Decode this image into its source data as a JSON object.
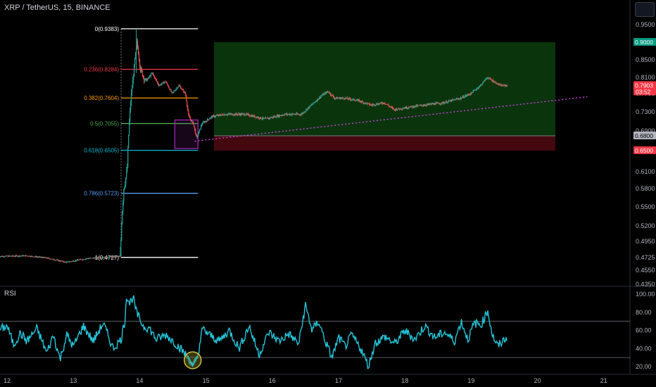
{
  "chart": {
    "symbol": "XRP / TetherUS, 15, BINANCE",
    "indicator_label": "RSI"
  },
  "chart_data": [
    {
      "type": "candlestick",
      "title": "XRP / TetherUS, 15, BINANCE",
      "x_ticks": [
        "12",
        "13",
        "14",
        "15",
        "16",
        "17",
        "18",
        "19",
        "20",
        "21"
      ],
      "x_tick_pos": [
        12,
        13,
        14,
        15,
        16,
        17,
        18,
        19,
        20,
        21
      ],
      "xlim": [
        11.87,
        21.37
      ],
      "y_ticks": [
        0.435,
        0.455,
        0.4725,
        0.495,
        0.52,
        0.55,
        0.58,
        0.61,
        0.65,
        0.69,
        0.73,
        0.77,
        0.81,
        0.85,
        0.9,
        0.95
      ],
      "y_tick_labels": [
        "0.4350",
        "0.4550",
        "0.4725",
        "0.4950",
        "0.5200",
        "0.5500",
        "0.5800",
        "0.6100",
        "0.6500",
        "0.6900",
        "0.7300",
        "0.7700",
        "0.8100",
        "0.8500",
        "0.9000",
        "0.9500"
      ],
      "fib_levels": [
        {
          "label": "0(0.9383)",
          "value": 0.9383,
          "color": "#ffffff"
        },
        {
          "label": "0.236(0.8284)",
          "value": 0.8284,
          "color": "#f23645"
        },
        {
          "label": "0.382(0.7604)",
          "value": 0.7604,
          "color": "#ff9800"
        },
        {
          "label": "0.5(0.7055)",
          "value": 0.7055,
          "color": "#4caf50"
        },
        {
          "label": "0.618(0.6505)",
          "value": 0.6505,
          "color": "#00bcd4"
        },
        {
          "label": "0.786(0.5723)",
          "value": 0.5723,
          "color": "#5b9cf6"
        },
        {
          "label": "1(0.4727)",
          "value": 0.4727,
          "color": "#ffffff"
        }
      ],
      "fib_x_range": [
        13.72,
        14.88
      ],
      "long_position": {
        "x_start": 15.12,
        "x_end": 20.27,
        "entry": 0.68,
        "target": 0.9,
        "stop": 0.65
      },
      "price_labels": [
        {
          "text": "0.9000",
          "value": 0.9,
          "color": "#089981"
        },
        {
          "text": "0.7903",
          "sub": "03:52",
          "value": 0.7903,
          "color": "#f23645"
        },
        {
          "text": "0.6800",
          "value": 0.68,
          "color": "#b2b5be"
        },
        {
          "text": "0.6500",
          "value": 0.65,
          "color": "#f23645"
        }
      ],
      "trendline": {
        "x1": 14.83,
        "y1": 0.669,
        "x2": 20.75,
        "y2": 0.763,
        "color": "#e040fb"
      },
      "highlight_box": {
        "x1": 14.53,
        "x2": 14.88,
        "y1": 0.654,
        "y2": 0.713,
        "color": "#9c27b0"
      },
      "price_path": [
        [
          11.87,
          0.474
        ],
        [
          12.3,
          0.475
        ],
        [
          12.6,
          0.472
        ],
        [
          12.9,
          0.466
        ],
        [
          13.2,
          0.471
        ],
        [
          13.5,
          0.473
        ],
        [
          13.72,
          0.474
        ],
        [
          13.74,
          0.53
        ],
        [
          13.77,
          0.58
        ],
        [
          13.82,
          0.61
        ],
        [
          13.85,
          0.7
        ],
        [
          13.88,
          0.76
        ],
        [
          13.92,
          0.82
        ],
        [
          13.97,
          0.9
        ],
        [
          14.02,
          0.83
        ],
        [
          14.1,
          0.8
        ],
        [
          14.2,
          0.82
        ],
        [
          14.3,
          0.79
        ],
        [
          14.4,
          0.8
        ],
        [
          14.5,
          0.77
        ],
        [
          14.6,
          0.79
        ],
        [
          14.7,
          0.77
        ],
        [
          14.75,
          0.72
        ],
        [
          14.82,
          0.705
        ],
        [
          14.87,
          0.675
        ],
        [
          14.95,
          0.705
        ],
        [
          15.1,
          0.72
        ],
        [
          15.3,
          0.725
        ],
        [
          15.6,
          0.725
        ],
        [
          15.9,
          0.715
        ],
        [
          16.2,
          0.725
        ],
        [
          16.45,
          0.725
        ],
        [
          16.6,
          0.745
        ],
        [
          16.75,
          0.765
        ],
        [
          16.85,
          0.775
        ],
        [
          16.95,
          0.76
        ],
        [
          17.1,
          0.76
        ],
        [
          17.3,
          0.755
        ],
        [
          17.5,
          0.745
        ],
        [
          17.7,
          0.75
        ],
        [
          17.85,
          0.735
        ],
        [
          18.05,
          0.74
        ],
        [
          18.3,
          0.745
        ],
        [
          18.6,
          0.75
        ],
        [
          18.85,
          0.76
        ],
        [
          19.0,
          0.77
        ],
        [
          19.15,
          0.79
        ],
        [
          19.25,
          0.81
        ],
        [
          19.35,
          0.8
        ],
        [
          19.45,
          0.79
        ],
        [
          19.55,
          0.79
        ]
      ]
    },
    {
      "type": "line",
      "title": "RSI",
      "y_ticks": [
        20,
        40,
        60,
        80,
        100
      ],
      "y_tick_labels": [
        "20.00",
        "40.00",
        "60.00",
        "80.00",
        "100.00"
      ],
      "ylim": [
        15,
        106
      ],
      "bands": [
        30,
        70
      ],
      "color": "#26c6da",
      "highlight": {
        "x": 14.8,
        "y": 27,
        "color": "#e8d44d"
      },
      "points": [
        [
          11.87,
          60
        ],
        [
          12.0,
          65
        ],
        [
          12.1,
          44
        ],
        [
          12.2,
          57
        ],
        [
          12.3,
          48
        ],
        [
          12.45,
          62
        ],
        [
          12.6,
          35
        ],
        [
          12.7,
          55
        ],
        [
          12.8,
          28
        ],
        [
          12.9,
          55
        ],
        [
          13.0,
          42
        ],
        [
          13.15,
          65
        ],
        [
          13.3,
          48
        ],
        [
          13.45,
          68
        ],
        [
          13.6,
          40
        ],
        [
          13.72,
          50
        ],
        [
          13.78,
          72
        ],
        [
          13.8,
          99
        ],
        [
          13.85,
          90
        ],
        [
          13.9,
          97
        ],
        [
          13.95,
          80
        ],
        [
          14.05,
          65
        ],
        [
          14.15,
          62
        ],
        [
          14.25,
          50
        ],
        [
          14.4,
          55
        ],
        [
          14.55,
          45
        ],
        [
          14.65,
          37
        ],
        [
          14.75,
          28
        ],
        [
          14.8,
          20
        ],
        [
          14.87,
          30
        ],
        [
          14.95,
          62
        ],
        [
          15.05,
          55
        ],
        [
          15.2,
          48
        ],
        [
          15.35,
          60
        ],
        [
          15.5,
          40
        ],
        [
          15.65,
          65
        ],
        [
          15.8,
          33
        ],
        [
          15.95,
          58
        ],
        [
          16.1,
          48
        ],
        [
          16.25,
          56
        ],
        [
          16.4,
          45
        ],
        [
          16.5,
          88
        ],
        [
          16.6,
          60
        ],
        [
          16.7,
          70
        ],
        [
          16.8,
          48
        ],
        [
          16.9,
          30
        ],
        [
          17.0,
          52
        ],
        [
          17.1,
          42
        ],
        [
          17.2,
          55
        ],
        [
          17.35,
          38
        ],
        [
          17.45,
          20
        ],
        [
          17.55,
          46
        ],
        [
          17.7,
          53
        ],
        [
          17.85,
          45
        ],
        [
          18.0,
          60
        ],
        [
          18.15,
          50
        ],
        [
          18.3,
          65
        ],
        [
          18.45,
          52
        ],
        [
          18.6,
          58
        ],
        [
          18.75,
          48
        ],
        [
          18.85,
          70
        ],
        [
          18.95,
          50
        ],
        [
          19.05,
          68
        ],
        [
          19.15,
          66
        ],
        [
          19.25,
          82
        ],
        [
          19.32,
          55
        ],
        [
          19.4,
          42
        ],
        [
          19.5,
          50
        ],
        [
          19.55,
          53
        ]
      ]
    }
  ]
}
